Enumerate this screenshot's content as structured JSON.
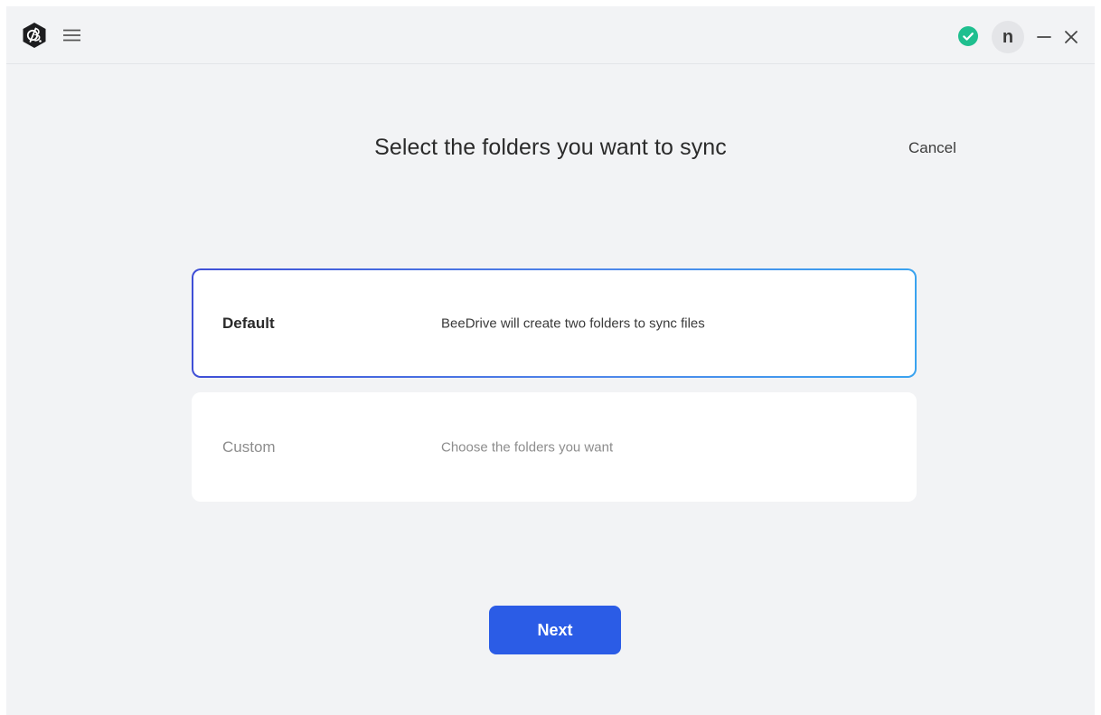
{
  "titlebar": {
    "logo_icon": "beedrive-logo-icon",
    "menu_icon": "hamburger-menu-icon",
    "status_icon": "check-circle-icon",
    "status_color": "#1fbf8f",
    "avatar_initial": "n",
    "minimize_icon": "minimize-icon",
    "close_icon": "close-icon"
  },
  "main": {
    "title": "Select the folders you want to sync",
    "cancel_label": "Cancel",
    "options": [
      {
        "name": "Default",
        "description": "BeeDrive will create two folders to sync files",
        "selected": true
      },
      {
        "name": "Custom",
        "description": "Choose the folders you want",
        "selected": false
      }
    ],
    "next_label": "Next"
  },
  "colors": {
    "accent": "#2b5ce6",
    "background": "#f2f3f5",
    "card": "#ffffff",
    "status": "#1fbf8f"
  }
}
